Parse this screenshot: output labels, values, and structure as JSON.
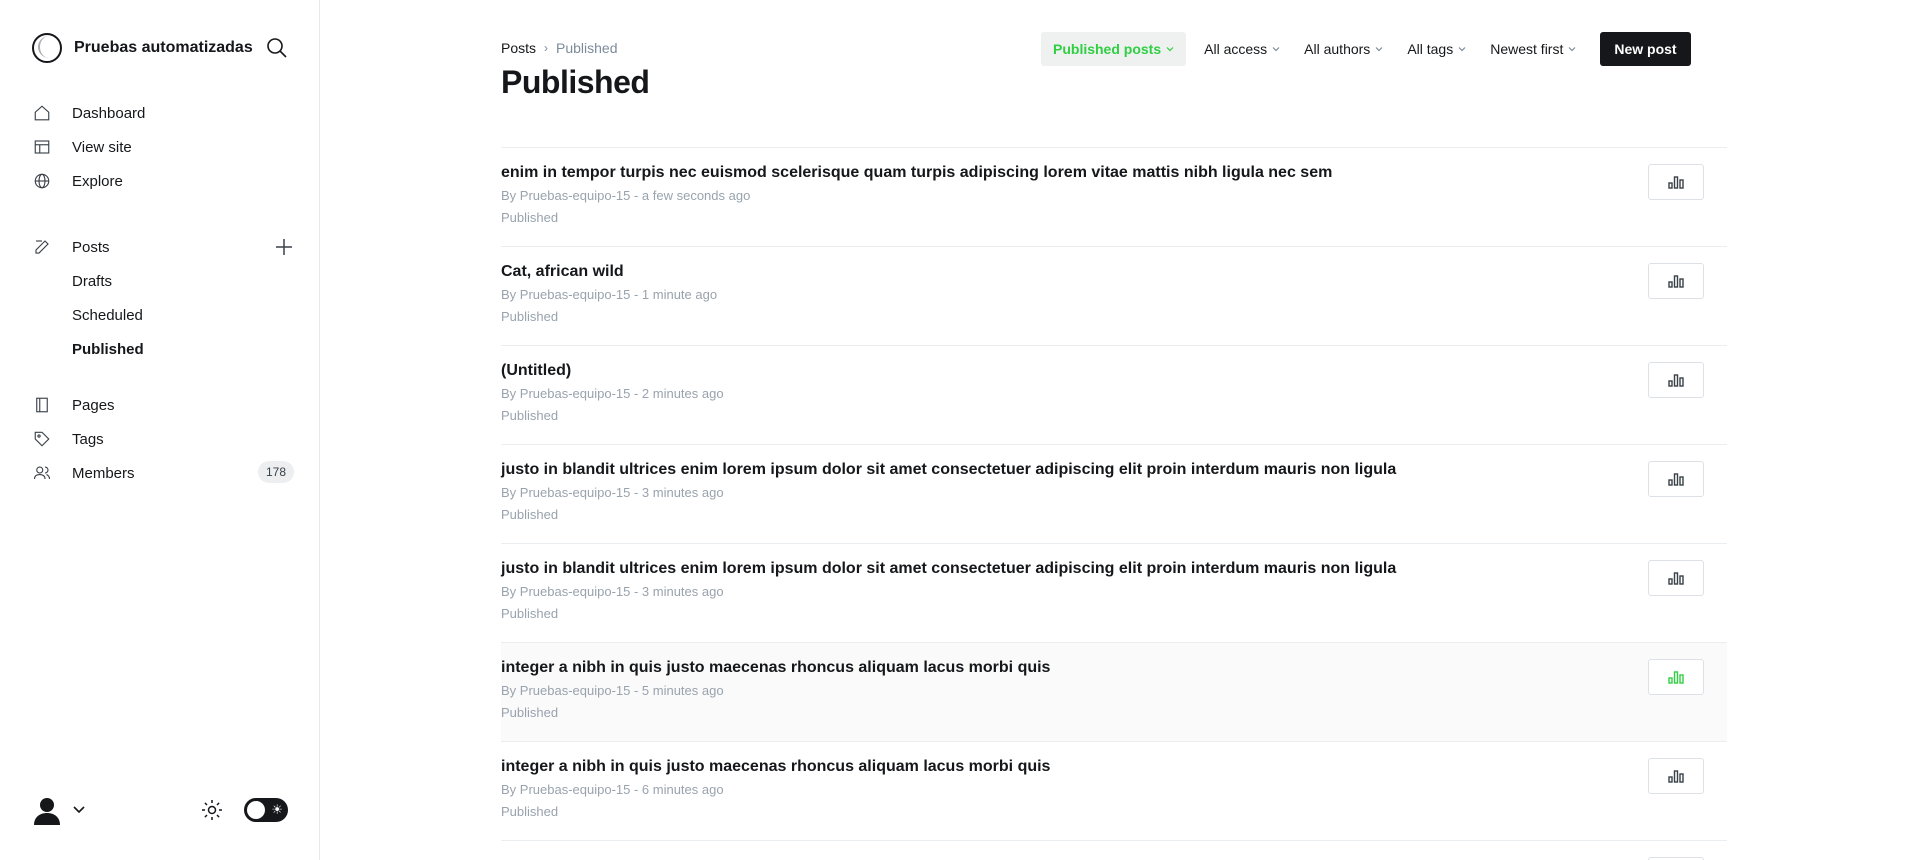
{
  "sidebar": {
    "site_title": "Pruebas automatizadas",
    "nav_primary": [
      {
        "label": "Dashboard",
        "icon": "home-icon"
      },
      {
        "label": "View site",
        "icon": "layout-icon"
      },
      {
        "label": "Explore",
        "icon": "globe-icon"
      }
    ],
    "posts": {
      "label": "Posts",
      "icon": "edit-icon"
    },
    "posts_sub": [
      {
        "label": "Drafts"
      },
      {
        "label": "Scheduled"
      },
      {
        "label": "Published"
      }
    ],
    "nav_secondary": [
      {
        "label": "Pages",
        "icon": "page-icon"
      },
      {
        "label": "Tags",
        "icon": "tag-icon"
      },
      {
        "label": "Members",
        "icon": "members-icon",
        "count": "178"
      }
    ]
  },
  "header": {
    "breadcrumb_root": "Posts",
    "breadcrumb_current": "Published",
    "title": "Published"
  },
  "filters": {
    "type": "Published posts",
    "access": "All access",
    "authors": "All authors",
    "tags": "All tags",
    "sort": "Newest first",
    "new_post": "New post"
  },
  "posts": [
    {
      "title": "enim in tempor turpis nec euismod scelerisque quam turpis adipiscing lorem vitae mattis nibh ligula nec sem",
      "meta": "By Pruebas-equipo-15 - a few seconds ago",
      "status": "Published"
    },
    {
      "title": "Cat, african wild",
      "meta": "By Pruebas-equipo-15 - 1 minute ago",
      "status": "Published"
    },
    {
      "title": "(Untitled)",
      "meta": "By Pruebas-equipo-15 - 2 minutes ago",
      "status": "Published"
    },
    {
      "title": "justo in blandit ultrices enim lorem ipsum dolor sit amet consectetuer adipiscing elit proin interdum mauris non ligula",
      "meta": "By Pruebas-equipo-15 - 3 minutes ago",
      "status": "Published"
    },
    {
      "title": "justo in blandit ultrices enim lorem ipsum dolor sit amet consectetuer adipiscing elit proin interdum mauris non ligula",
      "meta": "By Pruebas-equipo-15 - 3 minutes ago",
      "status": "Published"
    },
    {
      "title": "integer a nibh in quis justo maecenas rhoncus aliquam lacus morbi quis",
      "meta": "By Pruebas-equipo-15 - 5 minutes ago",
      "status": "Published"
    },
    {
      "title": "integer a nibh in quis justo maecenas rhoncus aliquam lacus morbi quis",
      "meta": "By Pruebas-equipo-15 - 6 minutes ago",
      "status": "Published"
    }
  ],
  "colors": {
    "accent": "#30cf43",
    "text": "#15171a",
    "muted": "#99a3ad",
    "border": "#ebeef0"
  }
}
